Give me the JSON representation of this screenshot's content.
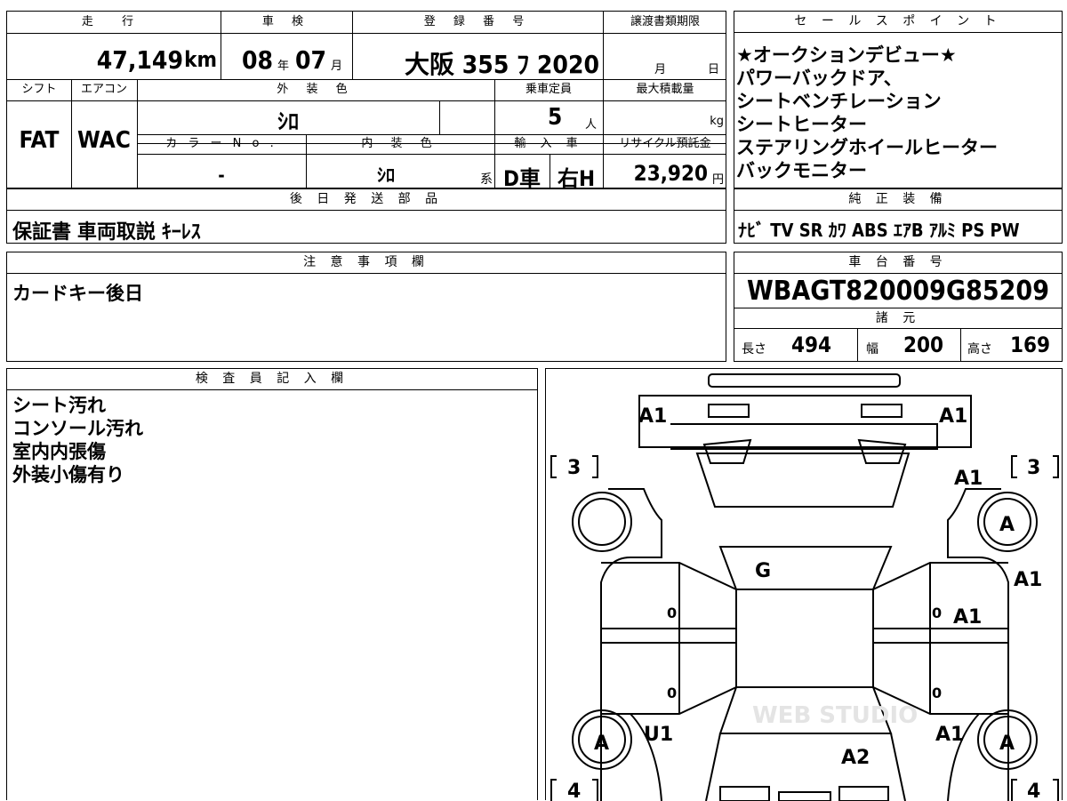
{
  "vehicle_info": {
    "mileage_label": "走 行",
    "mileage_value": "47,149",
    "mileage_unit": "km",
    "inspection_label": "車 検",
    "inspection_year": "08",
    "inspection_year_unit": "年",
    "inspection_month": "07",
    "inspection_month_unit": "月",
    "registration_label": "登 録 番 号",
    "registration_value": "大阪 355 ﾌ 2020",
    "transfer_deadline_label": "譲渡書類期限",
    "transfer_month_unit": "月",
    "transfer_day_unit": "日",
    "shift_label": "シフト",
    "shift_value": "FAT",
    "aircon_label": "エアコン",
    "aircon_value": "WAC",
    "exterior_color_label": "外 装 色",
    "exterior_color_value": "ｼﾛ",
    "capacity_label": "乗車定員",
    "capacity_value": "5",
    "capacity_unit": "人",
    "max_load_label": "最大積載量",
    "max_load_unit": "kg",
    "color_no_label": "カ ラ ー N o .",
    "color_no_value": "-",
    "interior_color_label": "内 装 色",
    "interior_color_value": "ｼﾛ",
    "interior_color_suffix": "系",
    "import_label": "輸 入 車",
    "import_value": "D車",
    "steering_value": "右H",
    "recycle_label": "リサイクル預託金",
    "recycle_value": "23,920",
    "recycle_unit": "円"
  },
  "sales_points": {
    "label": "セ ー ル ス ポ イ ン ト",
    "lines": [
      "★オークションデビュー★",
      "パワーバックドア、",
      "シートベンチレーション",
      "シートヒーター",
      "ステアリングホイールヒーター",
      "バックモニター"
    ]
  },
  "later_shipment": {
    "label": "後 日 発 送 部 品",
    "value": "保証書 車両取説 ｷｰﾚｽ"
  },
  "genuine_equipment": {
    "label": "純 正 装 備",
    "value": "ﾅﾋﾞ TV SR ｶﾜ ABS ｴｱB ｱﾙﾐ PS PW"
  },
  "notes": {
    "label": "注 意 事 項 欄",
    "value": "カードキー後日"
  },
  "chassis": {
    "label": "車 台 番 号",
    "value": "WBAGT820009G85209"
  },
  "specs": {
    "label": "諸 元",
    "length_label": "長さ",
    "length_value": "494",
    "width_label": "幅",
    "width_value": "200",
    "height_label": "高さ",
    "height_value": "169"
  },
  "inspector": {
    "label": "検 査 員 記 入 欄",
    "lines": [
      "シート汚れ",
      "コンソール汚れ",
      "室内内張傷",
      "外装小傷有り"
    ]
  },
  "diagram": {
    "marks": {
      "front_left": "A1",
      "front_right": "A1",
      "tire_front_left": "3",
      "tire_front_right": "3",
      "tire_rear_left": "4",
      "tire_rear_right": "4",
      "fender_front_right": "A1",
      "wheel_front_right": "A",
      "door_front_right_outer": "A1",
      "door_front_right_inner": "A1",
      "windshield": "G",
      "door_front_left_zero": "0",
      "door_rear_left_zero": "0",
      "door_front_right_zero": "0",
      "door_rear_right_zero": "0",
      "wheel_rear_left": "A",
      "rear_left_panel": "U1",
      "rear_right_panel": "A1",
      "wheel_rear_right": "A",
      "rear_center": "A2"
    },
    "watermark": "WEB STUDIO"
  }
}
